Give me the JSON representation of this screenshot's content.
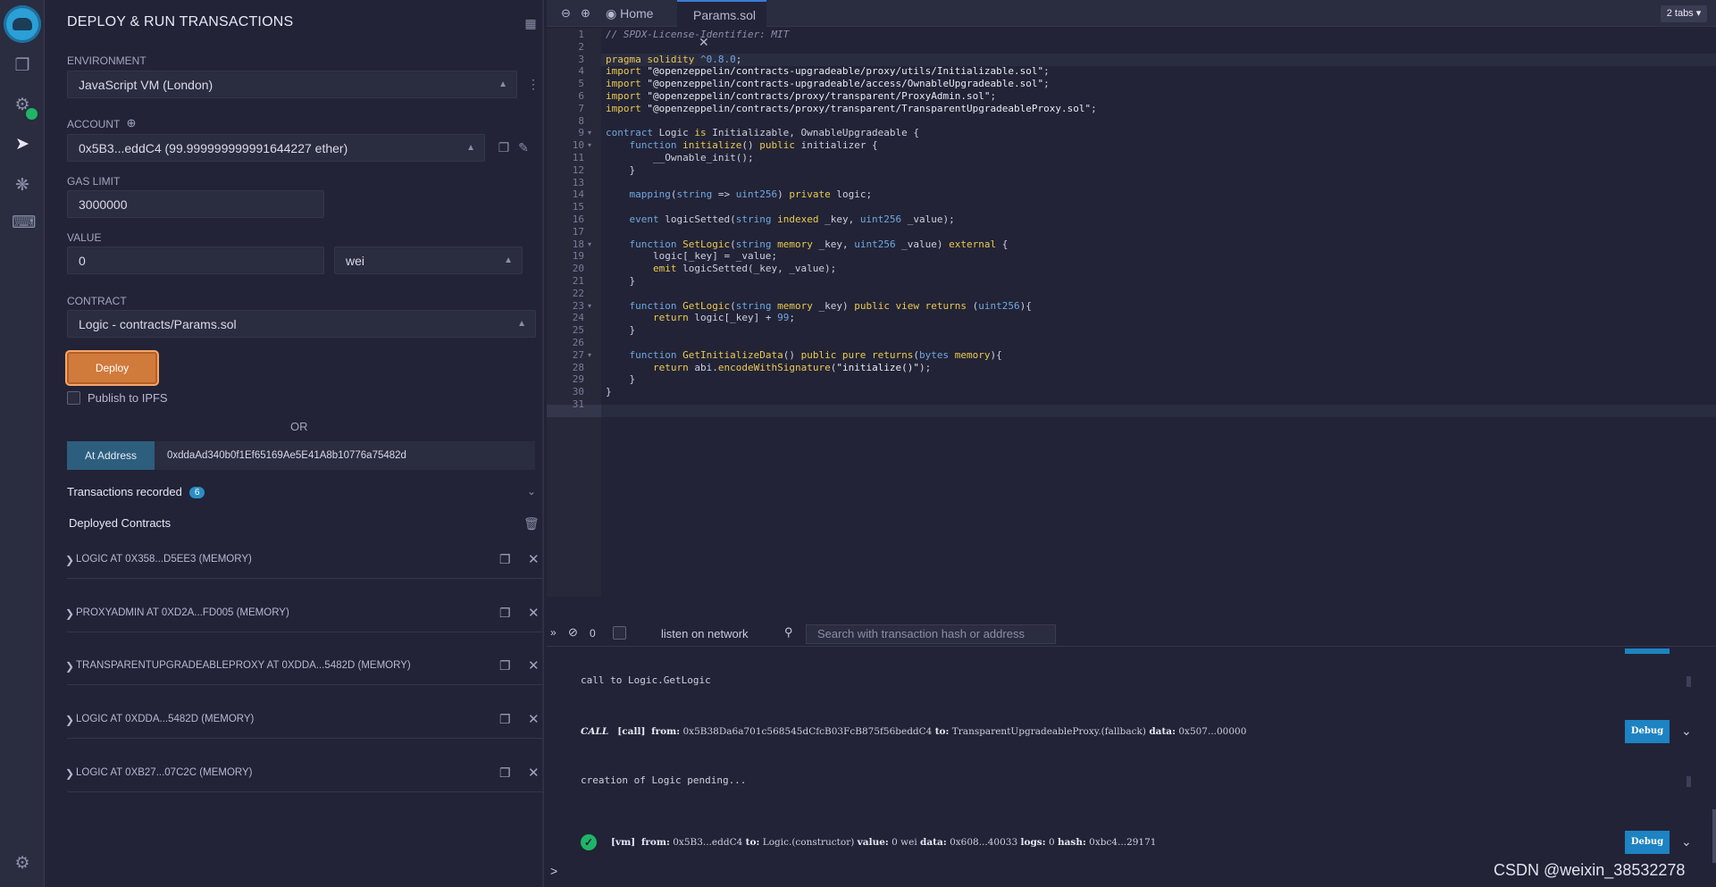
{
  "sidebar_icons": [
    "file-explorer-icon",
    "compiler-icon",
    "deploy-icon",
    "debugger-icon",
    "plugin-manager-icon",
    "settings-icon"
  ],
  "panel": {
    "title": "DEPLOY & RUN TRANSACTIONS",
    "environment_label": "ENVIRONMENT",
    "environment_value": "JavaScript VM (London)",
    "account_label": "ACCOUNT",
    "account_value": "0x5B3...eddC4 (99.999999999991644227 ether)",
    "gas_limit_label": "GAS LIMIT",
    "gas_limit_value": "3000000",
    "value_label": "VALUE",
    "value_amount": "0",
    "value_unit": "wei",
    "contract_label": "CONTRACT",
    "contract_value": "Logic - contracts/Params.sol",
    "deploy_label": "Deploy",
    "publish_label": "Publish to IPFS",
    "or_label": "OR",
    "at_address_label": "At Address",
    "at_address_value": "0xddaAd340b0f1Ef65169Ae5E41A8b10776a75482d",
    "transactions_label": "Transactions recorded",
    "transactions_count": "6",
    "deployed_label": "Deployed Contracts",
    "deployed": [
      "LOGIC AT 0X358...D5EE3 (MEMORY)",
      "PROXYADMIN AT 0XD2A...FD005 (MEMORY)",
      "TRANSPARENTUPGRADEABLEPROXY AT 0XDDA...5482D (MEMORY)",
      "LOGIC AT 0XDDA...5482D (MEMORY)",
      "LOGIC AT 0XB27...07C2C (MEMORY)"
    ]
  },
  "editor": {
    "home_tab": "Home",
    "file_tab": "Params.sol",
    "tabs_count": "2 tabs"
  },
  "terminal": {
    "count": "0",
    "listen_label": "listen on network",
    "search_placeholder": "Search with transaction hash or address",
    "log1": "call to Logic.GetLogic",
    "log2_tag": "CALL",
    "log2_text": "[call]",
    "log2_from_label": "from:",
    "log2_from": "0x5B38Da6a701c568545dCfcB03FcB875f56beddC4",
    "log2_to_label": "to:",
    "log2_to": "TransparentUpgradeableProxy.(fallback)",
    "log2_data_label": "data:",
    "log2_data": "0x507...00000",
    "log3": "creation of Logic pending...",
    "log4_tag": "[vm]",
    "log4_from_label": "from:",
    "log4_from": "0x5B3...eddC4",
    "log4_to_label": "to:",
    "log4_to": "Logic.(constructor)",
    "log4_value_label": "value:",
    "log4_value": "0 wei",
    "log4_data_label": "data:",
    "log4_data": "0x608...40033",
    "log4_logs_label": "logs:",
    "log4_logs": "0",
    "log4_hash_label": "hash:",
    "log4_hash": "0xbc4...29171",
    "debug_label": "Debug",
    "prompt": ">"
  },
  "watermark": "CSDN @weixin_38532278"
}
